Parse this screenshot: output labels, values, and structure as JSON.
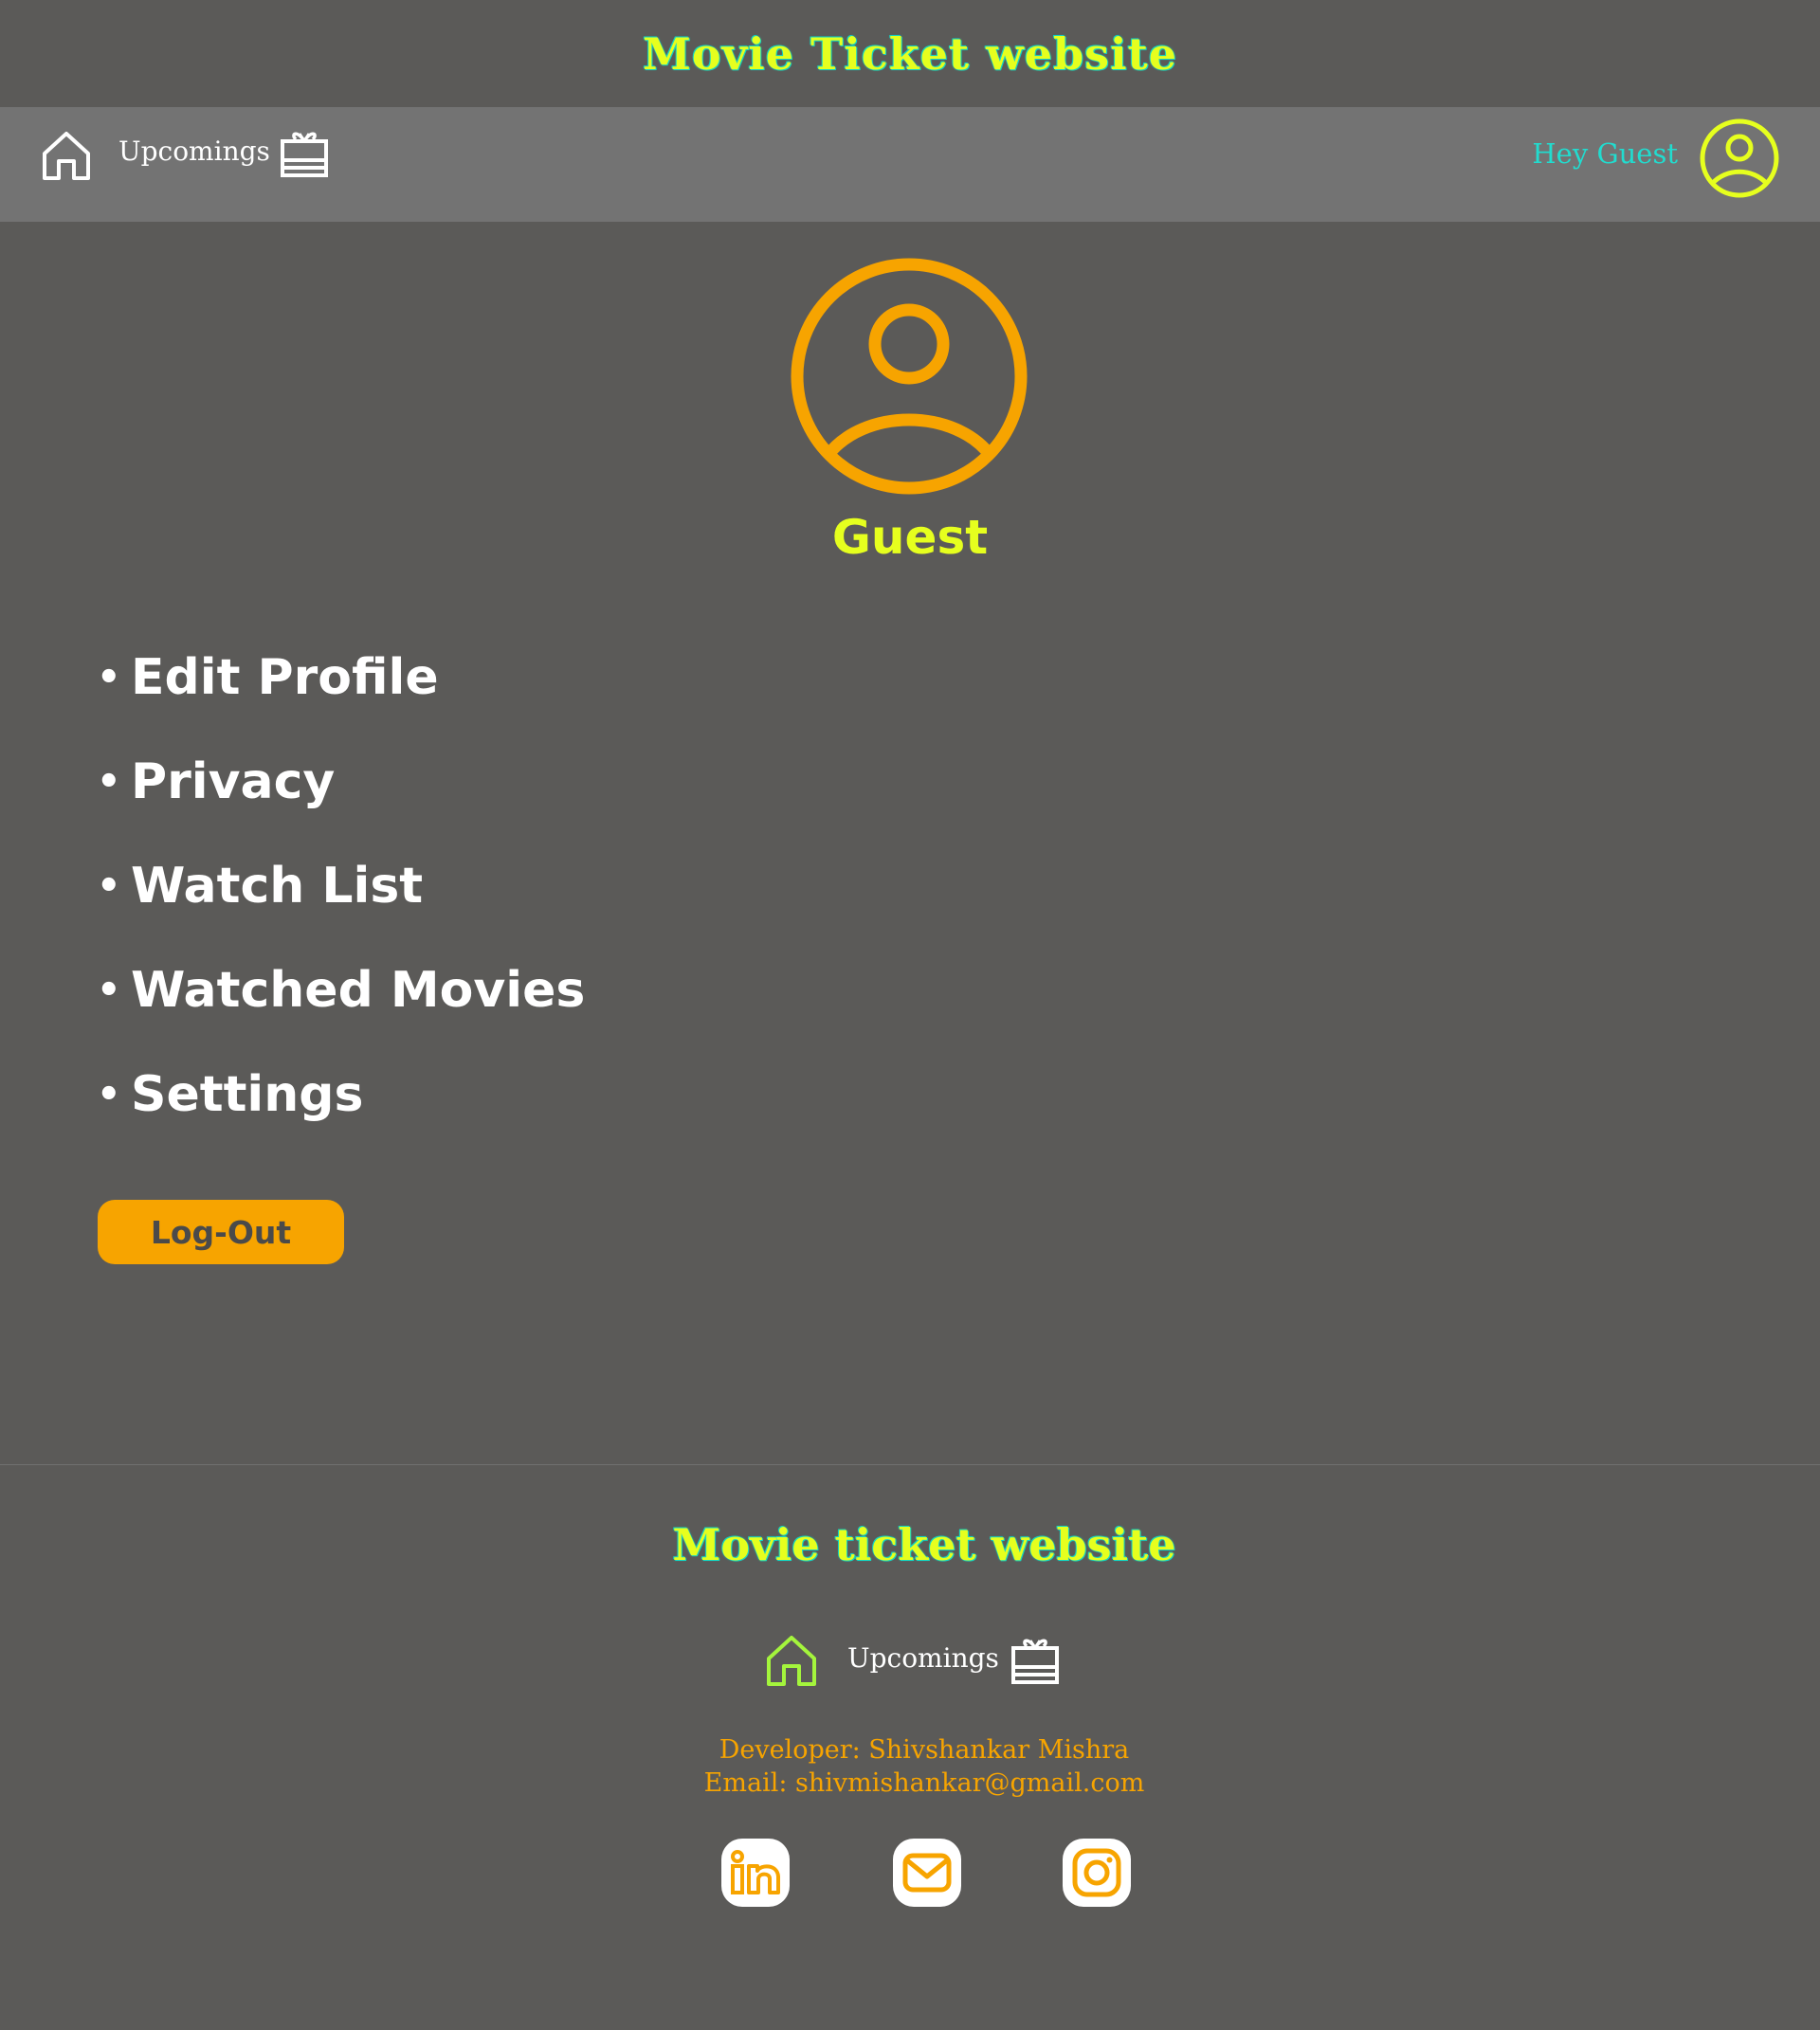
{
  "header": {
    "title": "Movie Ticket website"
  },
  "nav": {
    "home_icon": "home-icon",
    "upcomings_label": "Upcomings",
    "ticket_icon": "ticket-icon",
    "greeting": "Hey Guest",
    "avatar_icon": "user-circle-icon"
  },
  "profile": {
    "avatar_icon": "user-circle-icon",
    "name": "Guest",
    "menu": [
      {
        "label": "Edit Profile"
      },
      {
        "label": "Privacy"
      },
      {
        "label": "Watch List"
      },
      {
        "label": "Watched Movies"
      },
      {
        "label": "Settings"
      }
    ],
    "logout_label": "Log-Out"
  },
  "footer": {
    "title": "Movie ticket website",
    "upcomings_label": "Upcomings",
    "developer": "Developer: Shivshankar Mishra",
    "email": "Email: shivmishankar@gmail.com",
    "social": [
      {
        "icon": "linkedin-icon"
      },
      {
        "icon": "mail-icon"
      },
      {
        "icon": "instagram-icon"
      }
    ]
  },
  "colors": {
    "background": "#5b5a58",
    "navbar": "#737373",
    "title_yellow": "#e6ff1e",
    "title_outline": "#14d6c2",
    "greeting_teal": "#21dccf",
    "accent_orange": "#f7a400",
    "footer_home_green": "#a4f53c"
  }
}
